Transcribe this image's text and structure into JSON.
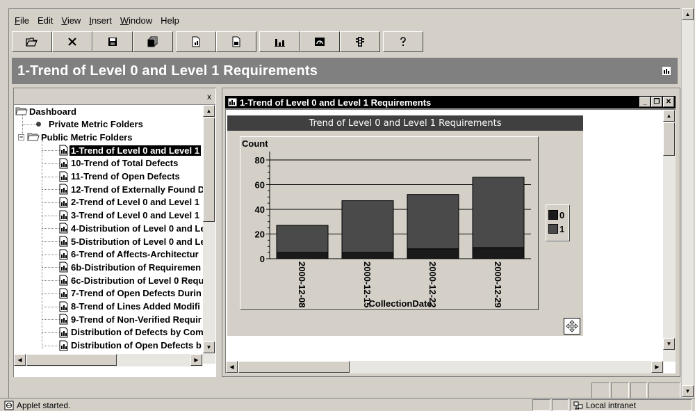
{
  "menu": [
    "File",
    "Edit",
    "View",
    "Insert",
    "Window",
    "Help"
  ],
  "menu_underline": [
    "F",
    "",
    "V",
    "I",
    "W",
    ""
  ],
  "toolbar_icons": [
    "open-folder-icon",
    "delete-icon",
    "save-icon",
    "copy-icon",
    "new-page-icon",
    "export-page-icon",
    "bar-chart-icon",
    "gauge-icon",
    "traffic-light-icon",
    "help-icon"
  ],
  "page_title": "1-Trend of Level 0 and Level 1 Requirements",
  "left_panel": {
    "close_label": "x",
    "tree": {
      "root": "Dashboard",
      "private": "Private Metric Folders",
      "public": "Public Metric Folders",
      "items": [
        "1-Trend of Level 0 and Level 1",
        "10-Trend of Total Defects",
        "11-Trend of Open Defects",
        "12-Trend of Externally Found D",
        "2-Trend of Level 0 and Level 1",
        "3-Trend of Level 0 and Level 1",
        "4-Distribution of Level 0 and Le",
        "5-Distribution of Level 0 and Le",
        "6-Trend of Affects-Architectur",
        "6b-Distribution of Requiremen",
        "6c-Distribution of Level 0 Requ",
        "7-Trend of Open Defects Durin",
        "8-Trend of Lines Added Modifi",
        "9-Trend of Non-Verified Requir",
        "Distribution of Defects by Com",
        "Distribution of Open Defects b"
      ],
      "selected_index": 0
    }
  },
  "window": {
    "title": "1-Trend of Level 0 and Level 1 Requirements",
    "controls": [
      "_",
      "❐",
      "✕"
    ]
  },
  "chart_data": {
    "type": "bar",
    "stacked": true,
    "title": "Trend of Level 0 and Level 1 Requirements",
    "ylabel": "Count",
    "xlabel": "CollectionDate",
    "categories": [
      "2000-12-08",
      "2000-12-15",
      "2000-12-22",
      "2000-12-29"
    ],
    "series": [
      {
        "name": "0",
        "values": [
          5,
          5,
          8,
          9
        ],
        "color": "#1a1a1a"
      },
      {
        "name": "1",
        "values": [
          22,
          42,
          44,
          57
        ],
        "color": "#4a4a4a"
      }
    ],
    "ylim": [
      0,
      80
    ],
    "yticks": [
      0,
      20,
      40,
      60,
      80
    ],
    "legend": "right"
  },
  "status": {
    "text": "Applet started.",
    "zone": "Local intranet"
  },
  "colors": {
    "chrome": "#d4d0c8",
    "title_bar": "#808080",
    "selection": "#000000"
  }
}
